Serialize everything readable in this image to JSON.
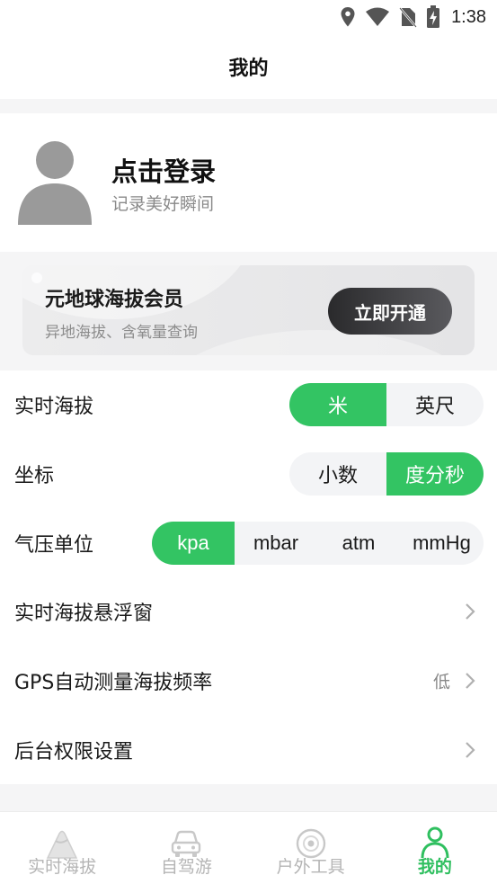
{
  "status_bar": {
    "time": "1:38"
  },
  "header": {
    "title": "我的"
  },
  "profile": {
    "title": "点击登录",
    "subtitle": "记录美好瞬间"
  },
  "membership": {
    "title": "元地球海拔会员",
    "subtitle": "异地海拔、含氧量查询",
    "button": "立即开通"
  },
  "settings": {
    "altitude": {
      "label": "实时海拔",
      "options": [
        "米",
        "英尺"
      ],
      "selected": "米"
    },
    "coordinate": {
      "label": "坐标",
      "options": [
        "小数",
        "度分秒"
      ],
      "selected": "度分秒"
    },
    "pressure": {
      "label": "气压单位",
      "options": [
        "kpa",
        "mbar",
        "atm",
        "mmHg"
      ],
      "selected": "kpa"
    },
    "floating_window": {
      "label": "实时海拔悬浮窗"
    },
    "gps_frequency": {
      "label": "GPS自动测量海拔频率",
      "value": "低"
    },
    "background_permission": {
      "label": "后台权限设置"
    }
  },
  "tabs": [
    {
      "label": "实时海拔",
      "icon": "mountain-icon"
    },
    {
      "label": "自驾游",
      "icon": "car-icon"
    },
    {
      "label": "户外工具",
      "icon": "compass-icon"
    },
    {
      "label": "我的",
      "icon": "person-icon",
      "active": true
    }
  ],
  "colors": {
    "accent": "#33c463",
    "tab_active": "#2fbf5f",
    "tab_inactive": "#b5b5b5"
  }
}
